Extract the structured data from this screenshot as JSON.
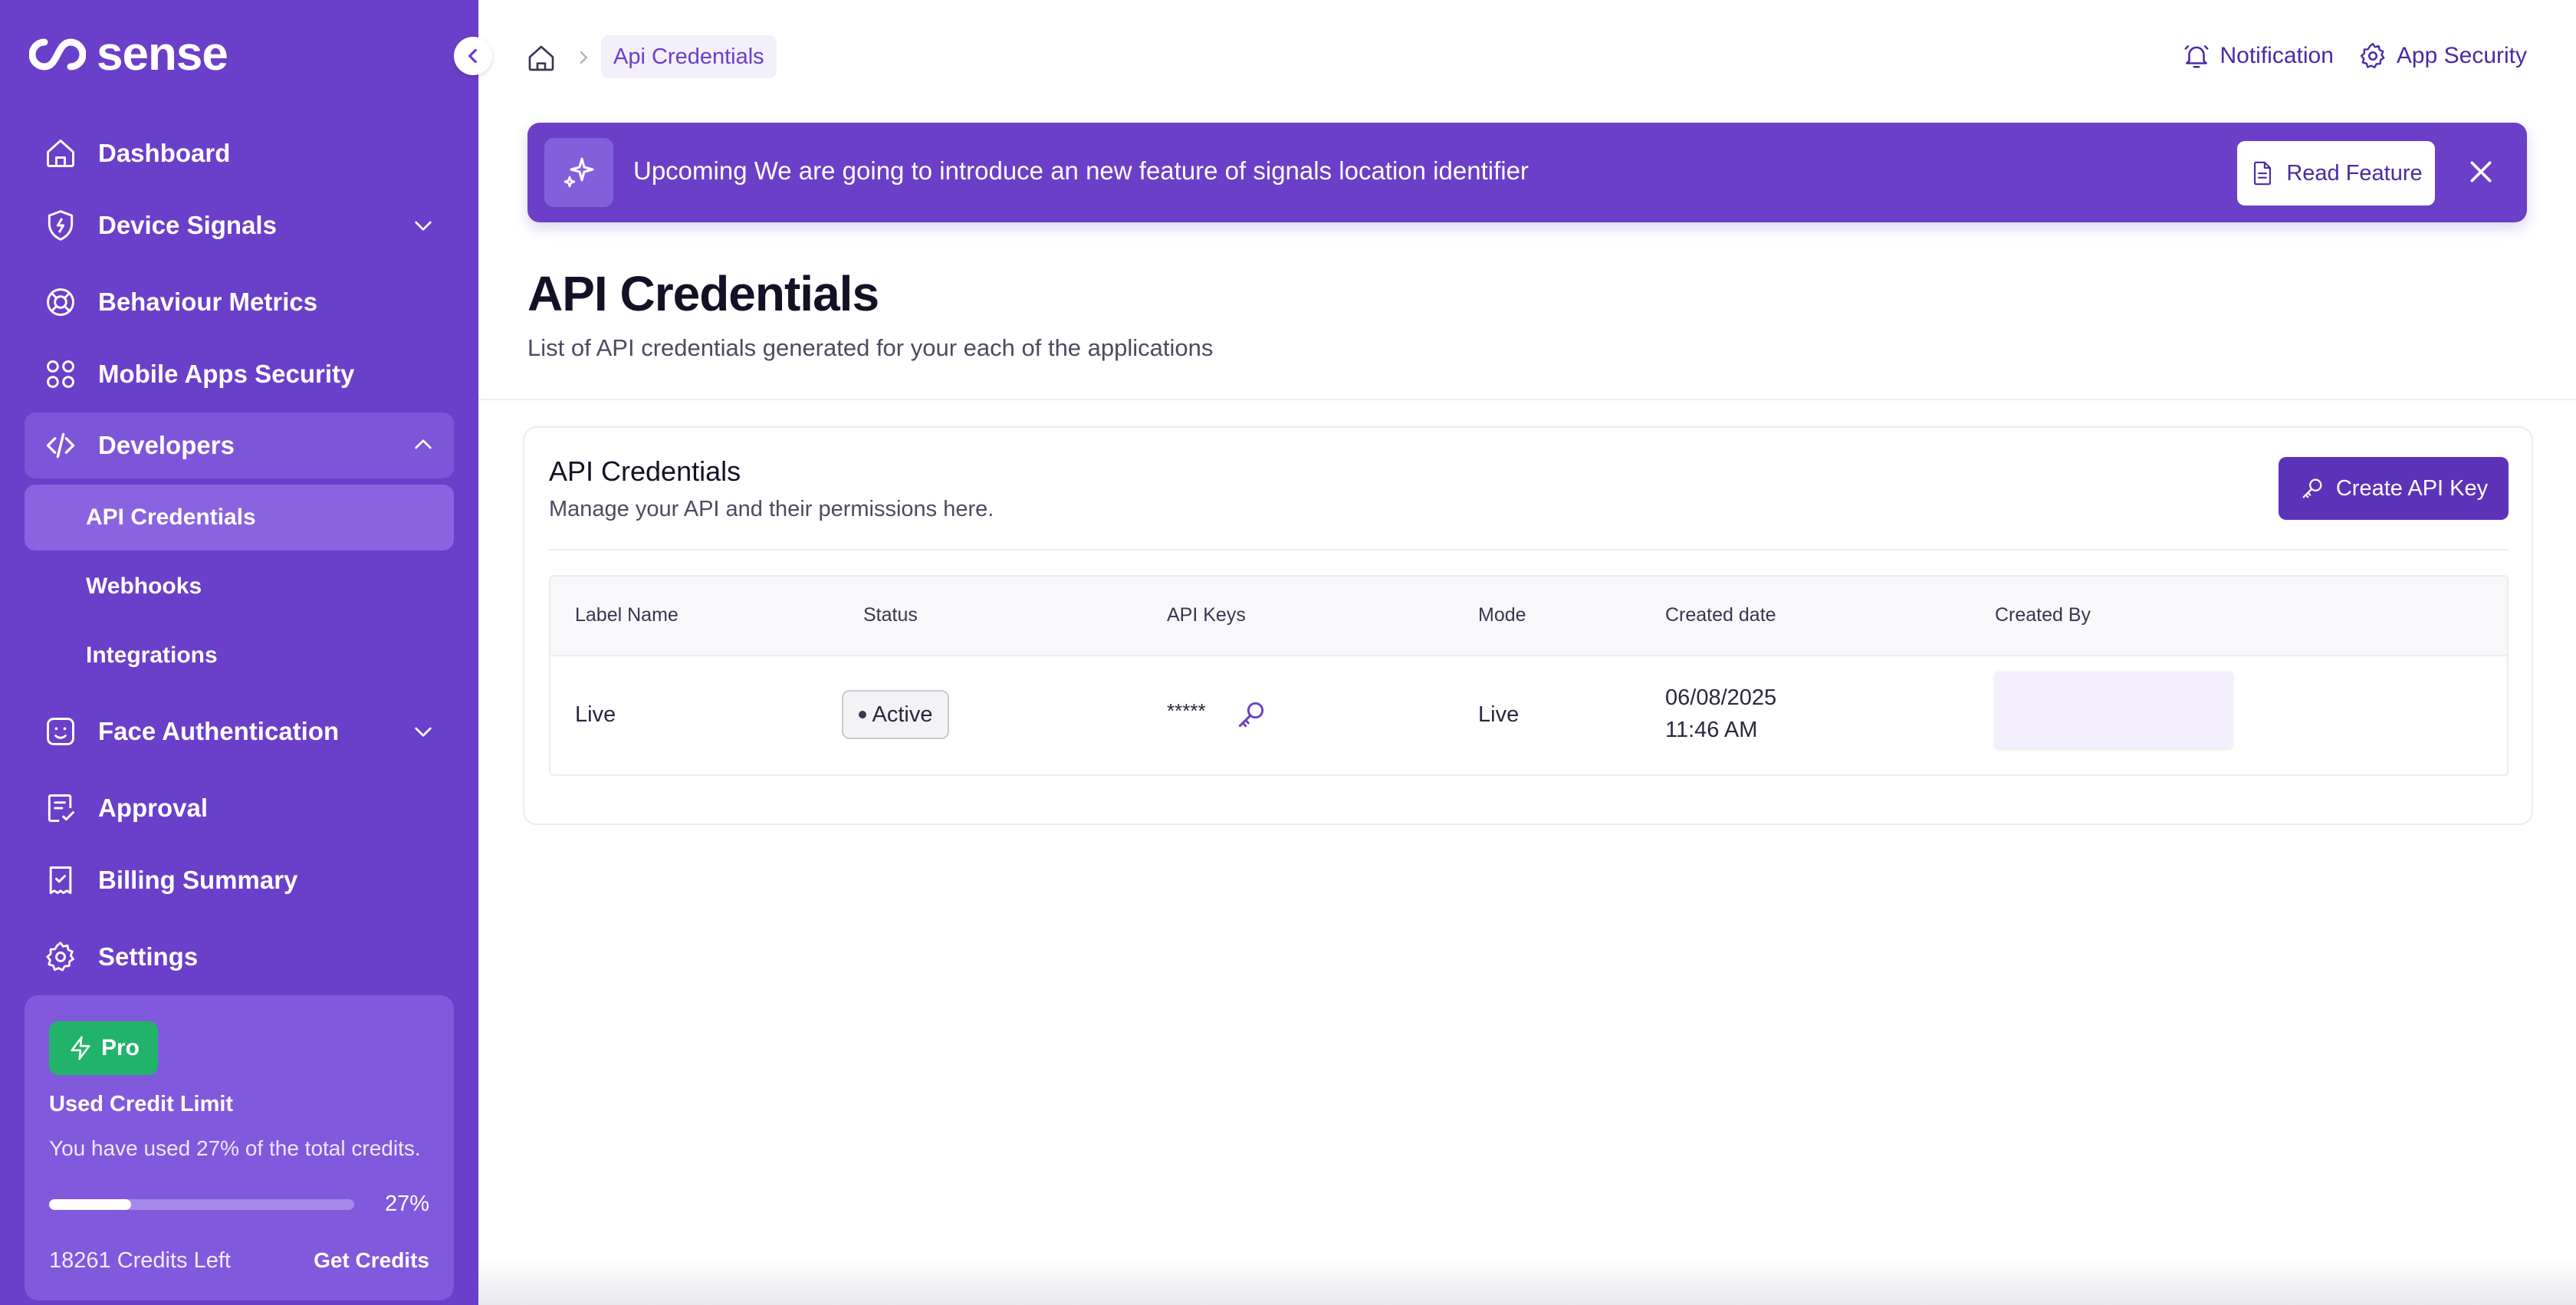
{
  "app": {
    "name": "sense"
  },
  "sidebar": {
    "items": [
      {
        "label": "Dashboard",
        "icon": "home-icon"
      },
      {
        "label": "Device Signals",
        "icon": "shield-bolt-icon",
        "expandable": true,
        "expanded": false
      },
      {
        "label": "Behaviour Metrics",
        "icon": "lifebuoy-icon"
      },
      {
        "label": "Mobile Apps Security",
        "icon": "grid-icon"
      },
      {
        "label": "Developers",
        "icon": "code-icon",
        "expandable": true,
        "expanded": true,
        "active": true,
        "children": [
          {
            "label": "API Credentials",
            "active": true
          },
          {
            "label": "Webhooks"
          },
          {
            "label": "Integrations"
          }
        ]
      },
      {
        "label": "Face Authentication",
        "icon": "face-scan-icon",
        "expandable": true,
        "expanded": false
      },
      {
        "label": "Approval",
        "icon": "checklist-icon"
      },
      {
        "label": "Billing Summary",
        "icon": "receipt-check-icon"
      },
      {
        "label": "Settings",
        "icon": "gear-icon"
      }
    ],
    "credit_card": {
      "plan": "Pro",
      "title": "Used Credit Limit",
      "description": "You have used 27% of the total credits.",
      "percent": 27,
      "percent_label": "27%",
      "credits_left": "18261 Credits Left",
      "cta": "Get Credits"
    }
  },
  "header": {
    "breadcrumb": {
      "home_icon": "home-icon",
      "current": "Api Credentials"
    },
    "notification_label": "Notification",
    "app_security_label": "App Security"
  },
  "banner": {
    "text": "Upcoming We are going to introduce an new feature of signals location identifier",
    "button_label": "Read Feature"
  },
  "page": {
    "title": "API Credentials",
    "subtitle": "List of API credentials generated for your each of the applications"
  },
  "card": {
    "title": "API Credentials",
    "subtitle": "Manage your API and their permissions here.",
    "create_button": "Create API Key",
    "table": {
      "columns": [
        "Label Name",
        "Status",
        "API Keys",
        "Mode",
        "Created date",
        "Created By"
      ],
      "rows": [
        {
          "label": "Live",
          "status": "Active",
          "api_key": "*****",
          "mode": "Live",
          "created_date": "06/08/2025",
          "created_time": "11:46 AM",
          "created_by": ""
        }
      ]
    }
  },
  "colors": {
    "sidebar_bg": "#6a3fc9",
    "accent": "#5c33b8",
    "pro_badge": "#22b36b"
  }
}
